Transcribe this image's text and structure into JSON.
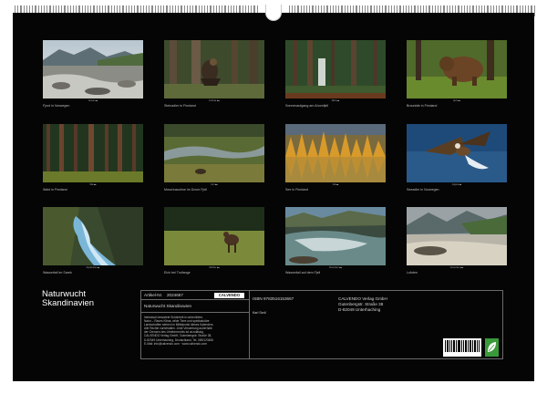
{
  "photos": [
    {
      "month": "Januar ■■",
      "caption": "Fjord in Norwegen"
    },
    {
      "month": "Februar ■■",
      "caption": "Steinadler in Finnland"
    },
    {
      "month": "März ■■",
      "caption": "Sonnenaufgang am Ahornfjell"
    },
    {
      "month": "April ■■",
      "caption": "Braunbär in Finnland"
    },
    {
      "month": "Mai ■■",
      "caption": "Wald in Finnland"
    },
    {
      "month": "Juni ■■",
      "caption": "Moschusochse im Dovre Fjell"
    },
    {
      "month": "Juli ■■",
      "caption": "See in Finnland"
    },
    {
      "month": "August ■■",
      "caption": "Seeadler in Norwegen"
    },
    {
      "month": "September ■■",
      "caption": "Wasserfall im Sarek"
    },
    {
      "month": "Oktober ■■",
      "caption": "Elch bei Trollange"
    },
    {
      "month": "November ■■",
      "caption": "Wasserfall auf dem Fjell"
    },
    {
      "month": "Dezember ■■",
      "caption": "Lofoten"
    }
  ],
  "cover": {
    "title_line1": "Naturwucht",
    "title_line2": "Skandinavien"
  },
  "info": {
    "article_label": "Artikel-Nr.",
    "article_no": "2024667",
    "logo": "CALVENDO",
    "product_title": "Naturwucht Skandinavien",
    "isbn": "ISBN 9783516153667",
    "author": "Karl Sedl",
    "publisher": [
      "CALVENDO Verlag GmbH",
      "Gutenbergstr. Straße 38",
      "D-82049 Unterhaching"
    ],
    "fineprint": [
      "Intrinsisch bewahrte Schönheit in unberührter,",
      "Natur – Raues Klima, wilde Tiere und spektakuläre",
      "Landschaften stehen im Mittelpunkt dieses Kalenders.",
      "Alle Rechte vorbehalten. Jede Verwertung außerhalb",
      "der Grenzen des Urheberrechts ist unzulässig.",
      "CALVENDO Verlag GmbH, Gutenbergstr. Straße 38,",
      "D-82049 Unterhaching, Deutschland, Tel. 089/123456",
      "E-Mail: info@calvendo.com · www.calvendo.com"
    ]
  },
  "colors": {
    "sheet": "#050505",
    "text": "#d6d6d6",
    "title": "#ffffff"
  }
}
